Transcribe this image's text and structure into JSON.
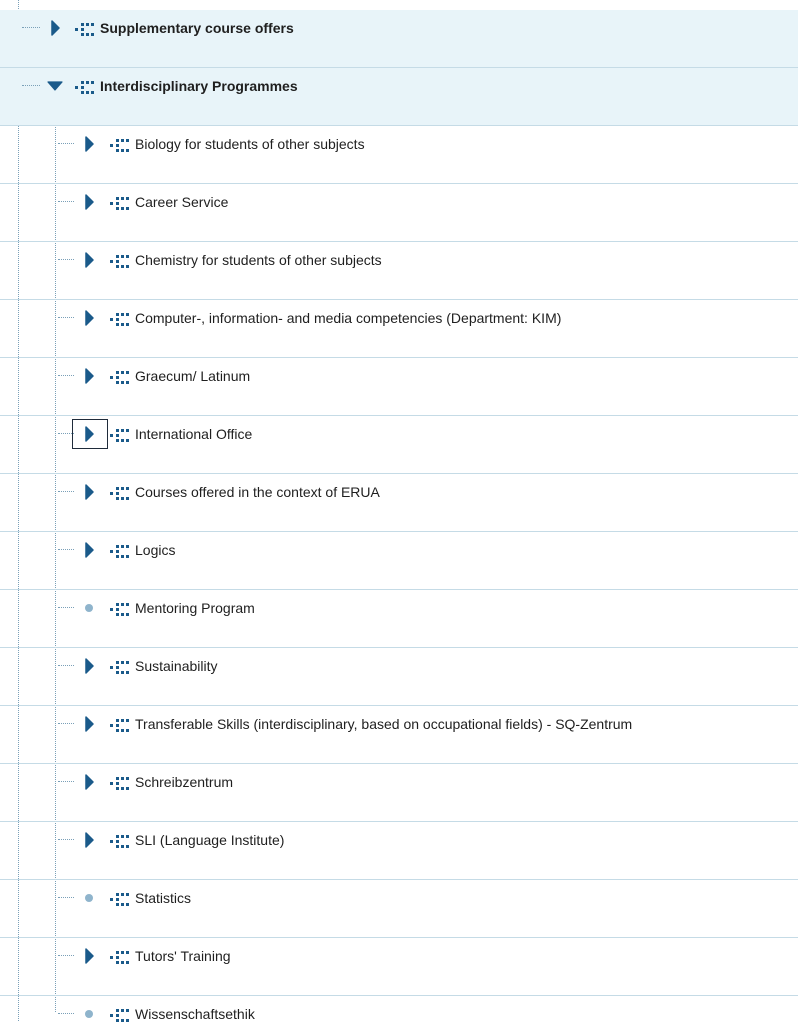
{
  "tree": {
    "top_nodes": [
      {
        "label": "Supplementary course offers",
        "state": "collapsed"
      },
      {
        "label": "Interdisciplinary Programmes",
        "state": "expanded"
      }
    ],
    "children": [
      {
        "label": "Biology for students of other subjects",
        "state": "collapsed"
      },
      {
        "label": "Career Service",
        "state": "collapsed"
      },
      {
        "label": "Chemistry for students of other subjects",
        "state": "collapsed"
      },
      {
        "label": "Computer-, information- and media competencies (Department: KIM)",
        "state": "collapsed"
      },
      {
        "label": "Graecum/ Latinum",
        "state": "collapsed"
      },
      {
        "label": "International Office",
        "state": "collapsed",
        "focused": true
      },
      {
        "label": "Courses offered in the context of ERUA",
        "state": "collapsed"
      },
      {
        "label": "Logics",
        "state": "collapsed"
      },
      {
        "label": "Mentoring Program",
        "state": "leaf"
      },
      {
        "label": "Sustainability",
        "state": "collapsed"
      },
      {
        "label": "Transferable Skills (interdisciplinary, based on occupational fields) - SQ-Zentrum",
        "state": "collapsed"
      },
      {
        "label": "Schreibzentrum",
        "state": "collapsed"
      },
      {
        "label": "SLI (Language Institute)",
        "state": "collapsed"
      },
      {
        "label": "Statistics",
        "state": "leaf"
      },
      {
        "label": "Tutors' Training",
        "state": "collapsed"
      },
      {
        "label": "Wissenschaftsethik",
        "state": "leaf"
      }
    ],
    "icons": {
      "collapsed": "chevron-right-icon",
      "expanded": "caret-down-icon",
      "leaf": "leaf-dot-icon",
      "node": "org-structure-icon"
    },
    "colors": {
      "accent": "#1a5a8a",
      "top_row_bg": "#e8f4f9",
      "separator": "#c5dbe6",
      "leaf_dot": "#8fb4cc"
    }
  }
}
